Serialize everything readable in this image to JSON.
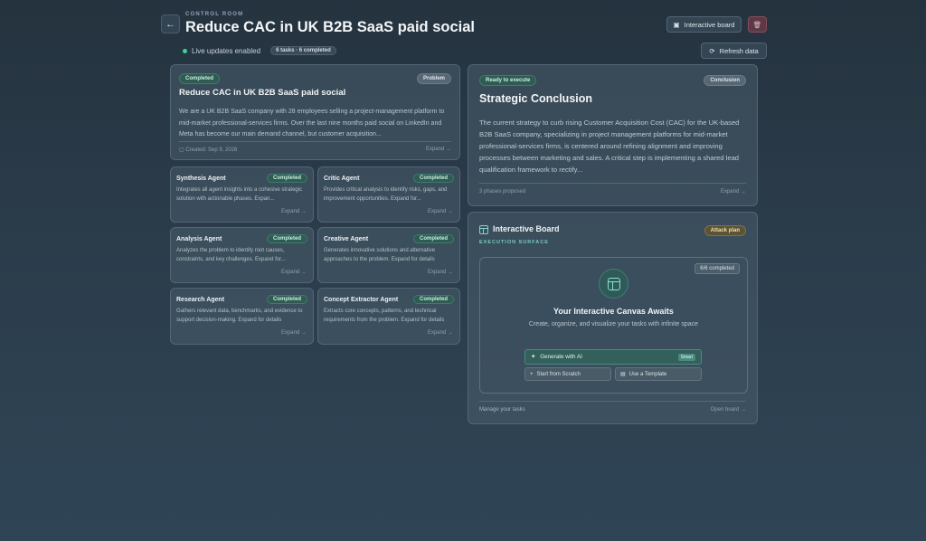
{
  "header": {
    "eyebrow": "CONTROL ROOM",
    "title": "Reduce CAC in UK B2B SaaS paid social",
    "live_label": "Live updates enabled",
    "tasks_badge": "6 tasks · 6 completed",
    "back_icon": "arrow-left-icon"
  },
  "toolbar": {
    "board_button": "Interactive board",
    "refresh_button": "Refresh data",
    "delete_icon": "trash-icon"
  },
  "problem": {
    "status": "Completed",
    "tag": "Problem",
    "title": "Reduce CAC in UK B2B SaaS paid social",
    "text": "We are a UK B2B SaaS company with 28 employees selling a project-management platform to mid-market professional-services firms. Over the last nine months paid social on LinkedIn and Meta has become our main demand channel, but customer acquisition...",
    "created": "Created: Sep 9, 2026",
    "expand": "Expand →"
  },
  "agents": [
    {
      "name": "Synthesis Agent",
      "status": "Completed",
      "desc": "Integrates all agent insights into a cohesive strategic solution with actionable phases. Expan...",
      "expand": "Expand →"
    },
    {
      "name": "Critic Agent",
      "status": "Completed",
      "desc": "Provides critical analysis to identify risks, gaps, and improvement opportunities. Expand for...",
      "expand": "Expand →"
    },
    {
      "name": "Analysis Agent",
      "status": "Completed",
      "desc": "Analyzes the problem to identify root causes, constraints, and key challenges. Expand for...",
      "expand": "Expand →"
    },
    {
      "name": "Creative Agent",
      "status": "Completed",
      "desc": "Generates innovative solutions and alternative approaches to the problem. Expand for details",
      "expand": "Expand →"
    },
    {
      "name": "Research Agent",
      "status": "Completed",
      "desc": "Gathers relevant data, benchmarks, and evidence to support decision-making. Expand for details",
      "expand": "Expand →"
    },
    {
      "name": "Concept Extractor Agent",
      "status": "Completed",
      "desc": "Extracts core concepts, patterns, and technical requirements from the problem. Expand for details",
      "expand": "Expand →"
    }
  ],
  "conclusion": {
    "status": "Ready to execute",
    "tag": "Conclusion",
    "title": "Strategic Conclusion",
    "text": "The current strategy to curb rising Customer Acquisition Cost (CAC) for the UK-based B2B SaaS company, specializing in project management platforms for mid-market professional-services firms, is centered around refining alignment and improving processes between marketing and sales. A critical step is implementing a shared lead qualification framework to rectify...",
    "phases": "3 phases proposed",
    "expand": "Expand →"
  },
  "board": {
    "title": "Interactive Board",
    "tag": "Attack plan",
    "surface_label": "EXECUTION SURFACE",
    "completed_pill": "6/6 completed",
    "canvas_title": "Your Interactive Canvas Awaits",
    "canvas_sub": "Create, organize, and visualize your tasks with infinite space",
    "generate_label": "Generate with AI",
    "smart_label": "Smart",
    "scratch_label": "Start from Scratch",
    "template_label": "Use a Template",
    "footer_left": "Manage your tasks",
    "footer_right": "Open board →"
  },
  "colors": {
    "accent": "#3fd29a",
    "completed_pill": "#2f5b53",
    "attack_pill": "#5b5335",
    "delete_button": "#5a3a45"
  }
}
